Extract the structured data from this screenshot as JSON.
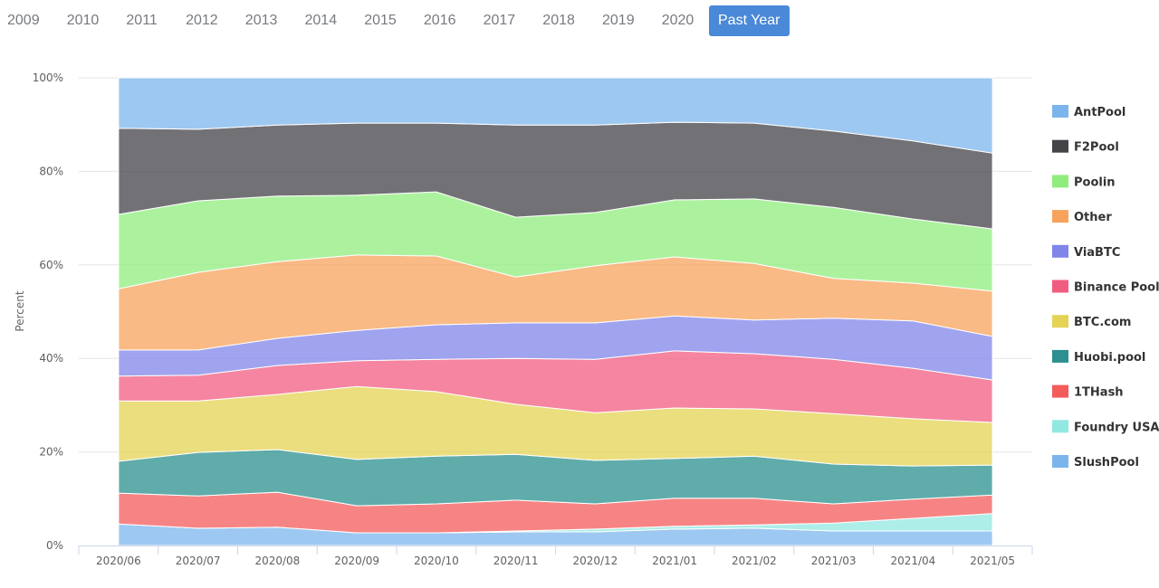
{
  "year_nav": {
    "items": [
      "2009",
      "2010",
      "2011",
      "2012",
      "2013",
      "2014",
      "2015",
      "2016",
      "2017",
      "2018",
      "2019",
      "2020",
      "Past Year"
    ],
    "active": "Past Year"
  },
  "chart_data": {
    "type": "area",
    "stacking": "percent",
    "title": "",
    "xlabel": "",
    "ylabel": "Percent",
    "ylim": [
      0,
      100
    ],
    "yticks": [
      "0%",
      "20%",
      "40%",
      "60%",
      "80%",
      "100%"
    ],
    "grid": true,
    "legend_position": "right",
    "categories": [
      "2020/06",
      "2020/07",
      "2020/08",
      "2020/09",
      "2020/10",
      "2020/11",
      "2020/12",
      "2021/01",
      "2021/02",
      "2021/03",
      "2021/04",
      "2021/05"
    ],
    "series": [
      {
        "name": "AntPool",
        "color": "#7cb5ec",
        "values": [
          10.8,
          11.0,
          10.1,
          9.7,
          9.7,
          10.1,
          10.1,
          9.5,
          9.7,
          11.4,
          13.5,
          16.1
        ]
      },
      {
        "name": "F2Pool",
        "color": "#434348",
        "values": [
          18.4,
          15.3,
          15.2,
          15.4,
          14.7,
          19.7,
          18.7,
          16.6,
          16.2,
          16.3,
          16.7,
          16.2
        ]
      },
      {
        "name": "Poolin",
        "color": "#90ed7d",
        "values": [
          15.9,
          15.3,
          14.0,
          12.8,
          13.7,
          12.8,
          11.4,
          12.2,
          13.8,
          15.2,
          13.7,
          13.3
        ]
      },
      {
        "name": "Other",
        "color": "#f7a35c",
        "values": [
          13.1,
          16.6,
          16.4,
          16.1,
          14.7,
          9.8,
          12.2,
          12.6,
          12.1,
          8.5,
          8.1,
          9.7
        ]
      },
      {
        "name": "ViaBTC",
        "color": "#8085e9",
        "values": [
          5.6,
          5.4,
          5.8,
          6.5,
          7.4,
          7.6,
          7.8,
          7.5,
          7.2,
          8.8,
          10.1,
          9.3
        ]
      },
      {
        "name": "Binance Pool",
        "color": "#f15c80",
        "values": [
          5.3,
          5.5,
          6.2,
          5.5,
          6.9,
          9.8,
          11.4,
          12.2,
          11.8,
          11.6,
          10.8,
          9.1
        ]
      },
      {
        "name": "BTC.com",
        "color": "#e4d354",
        "values": [
          12.9,
          11.0,
          11.8,
          15.6,
          13.8,
          10.7,
          10.2,
          10.8,
          10.1,
          10.8,
          10.1,
          9.1
        ]
      },
      {
        "name": "Huobi.pool",
        "color": "#2b908f",
        "values": [
          6.8,
          9.3,
          9.1,
          9.9,
          10.2,
          9.8,
          9.3,
          8.5,
          9.0,
          8.5,
          7.1,
          6.4
        ]
      },
      {
        "name": "1THash",
        "color": "#f45b5b",
        "values": [
          6.6,
          6.9,
          7.5,
          5.8,
          6.2,
          6.6,
          5.4,
          6.0,
          5.7,
          4.1,
          4.1,
          4.0
        ]
      },
      {
        "name": "Foundry USA",
        "color": "#91e8e1",
        "values": [
          0,
          0,
          0,
          0,
          0,
          0.2,
          0.6,
          0.6,
          0.7,
          1.7,
          2.7,
          3.7
        ]
      },
      {
        "name": "SlushPool",
        "color": "#7cb5ec",
        "values": [
          4.6,
          3.7,
          3.9,
          2.7,
          2.7,
          2.9,
          2.9,
          3.5,
          3.7,
          3.1,
          3.1,
          3.1
        ]
      }
    ]
  }
}
